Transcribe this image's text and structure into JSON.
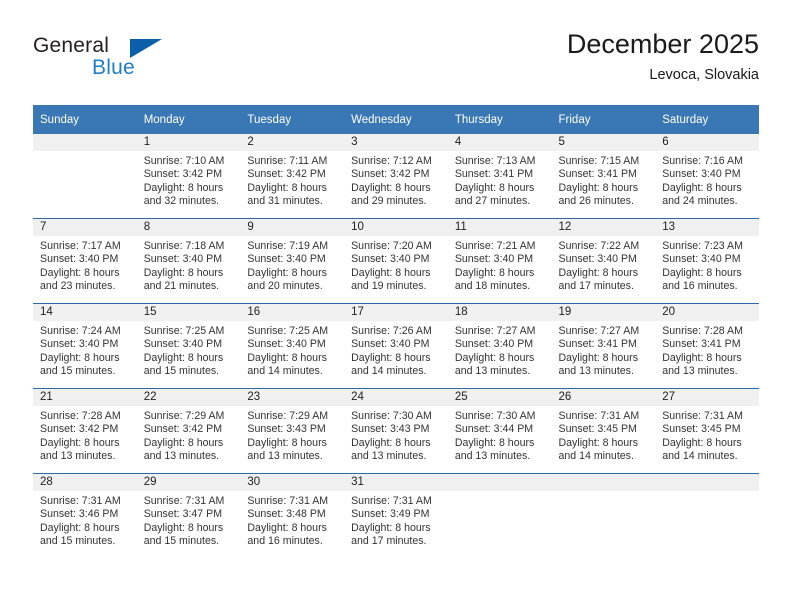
{
  "brand": {
    "name_part1": "General",
    "name_part2": "Blue"
  },
  "header": {
    "title": "December 2025",
    "location": "Levoca, Slovakia"
  },
  "weekday_headers": [
    "Sunday",
    "Monday",
    "Tuesday",
    "Wednesday",
    "Thursday",
    "Friday",
    "Saturday"
  ],
  "colors": {
    "header_blue": "#3978b5",
    "row_divider_blue": "#2a6ba8",
    "daynum_band": "#f0f0f0",
    "logo_blue": "#1f7ec4",
    "logo_triangle": "#0b5ea8"
  },
  "weeks": [
    [
      {
        "day": "",
        "sunrise": "",
        "sunset": "",
        "daylight1": "",
        "daylight2": "",
        "empty": true
      },
      {
        "day": "1",
        "sunrise": "Sunrise: 7:10 AM",
        "sunset": "Sunset: 3:42 PM",
        "daylight1": "Daylight: 8 hours",
        "daylight2": "and 32 minutes.",
        "empty": false
      },
      {
        "day": "2",
        "sunrise": "Sunrise: 7:11 AM",
        "sunset": "Sunset: 3:42 PM",
        "daylight1": "Daylight: 8 hours",
        "daylight2": "and 31 minutes.",
        "empty": false
      },
      {
        "day": "3",
        "sunrise": "Sunrise: 7:12 AM",
        "sunset": "Sunset: 3:42 PM",
        "daylight1": "Daylight: 8 hours",
        "daylight2": "and 29 minutes.",
        "empty": false
      },
      {
        "day": "4",
        "sunrise": "Sunrise: 7:13 AM",
        "sunset": "Sunset: 3:41 PM",
        "daylight1": "Daylight: 8 hours",
        "daylight2": "and 27 minutes.",
        "empty": false
      },
      {
        "day": "5",
        "sunrise": "Sunrise: 7:15 AM",
        "sunset": "Sunset: 3:41 PM",
        "daylight1": "Daylight: 8 hours",
        "daylight2": "and 26 minutes.",
        "empty": false
      },
      {
        "day": "6",
        "sunrise": "Sunrise: 7:16 AM",
        "sunset": "Sunset: 3:40 PM",
        "daylight1": "Daylight: 8 hours",
        "daylight2": "and 24 minutes.",
        "empty": false
      }
    ],
    [
      {
        "day": "7",
        "sunrise": "Sunrise: 7:17 AM",
        "sunset": "Sunset: 3:40 PM",
        "daylight1": "Daylight: 8 hours",
        "daylight2": "and 23 minutes.",
        "empty": false
      },
      {
        "day": "8",
        "sunrise": "Sunrise: 7:18 AM",
        "sunset": "Sunset: 3:40 PM",
        "daylight1": "Daylight: 8 hours",
        "daylight2": "and 21 minutes.",
        "empty": false
      },
      {
        "day": "9",
        "sunrise": "Sunrise: 7:19 AM",
        "sunset": "Sunset: 3:40 PM",
        "daylight1": "Daylight: 8 hours",
        "daylight2": "and 20 minutes.",
        "empty": false
      },
      {
        "day": "10",
        "sunrise": "Sunrise: 7:20 AM",
        "sunset": "Sunset: 3:40 PM",
        "daylight1": "Daylight: 8 hours",
        "daylight2": "and 19 minutes.",
        "empty": false
      },
      {
        "day": "11",
        "sunrise": "Sunrise: 7:21 AM",
        "sunset": "Sunset: 3:40 PM",
        "daylight1": "Daylight: 8 hours",
        "daylight2": "and 18 minutes.",
        "empty": false
      },
      {
        "day": "12",
        "sunrise": "Sunrise: 7:22 AM",
        "sunset": "Sunset: 3:40 PM",
        "daylight1": "Daylight: 8 hours",
        "daylight2": "and 17 minutes.",
        "empty": false
      },
      {
        "day": "13",
        "sunrise": "Sunrise: 7:23 AM",
        "sunset": "Sunset: 3:40 PM",
        "daylight1": "Daylight: 8 hours",
        "daylight2": "and 16 minutes.",
        "empty": false
      }
    ],
    [
      {
        "day": "14",
        "sunrise": "Sunrise: 7:24 AM",
        "sunset": "Sunset: 3:40 PM",
        "daylight1": "Daylight: 8 hours",
        "daylight2": "and 15 minutes.",
        "empty": false
      },
      {
        "day": "15",
        "sunrise": "Sunrise: 7:25 AM",
        "sunset": "Sunset: 3:40 PM",
        "daylight1": "Daylight: 8 hours",
        "daylight2": "and 15 minutes.",
        "empty": false
      },
      {
        "day": "16",
        "sunrise": "Sunrise: 7:25 AM",
        "sunset": "Sunset: 3:40 PM",
        "daylight1": "Daylight: 8 hours",
        "daylight2": "and 14 minutes.",
        "empty": false
      },
      {
        "day": "17",
        "sunrise": "Sunrise: 7:26 AM",
        "sunset": "Sunset: 3:40 PM",
        "daylight1": "Daylight: 8 hours",
        "daylight2": "and 14 minutes.",
        "empty": false
      },
      {
        "day": "18",
        "sunrise": "Sunrise: 7:27 AM",
        "sunset": "Sunset: 3:40 PM",
        "daylight1": "Daylight: 8 hours",
        "daylight2": "and 13 minutes.",
        "empty": false
      },
      {
        "day": "19",
        "sunrise": "Sunrise: 7:27 AM",
        "sunset": "Sunset: 3:41 PM",
        "daylight1": "Daylight: 8 hours",
        "daylight2": "and 13 minutes.",
        "empty": false
      },
      {
        "day": "20",
        "sunrise": "Sunrise: 7:28 AM",
        "sunset": "Sunset: 3:41 PM",
        "daylight1": "Daylight: 8 hours",
        "daylight2": "and 13 minutes.",
        "empty": false
      }
    ],
    [
      {
        "day": "21",
        "sunrise": "Sunrise: 7:28 AM",
        "sunset": "Sunset: 3:42 PM",
        "daylight1": "Daylight: 8 hours",
        "daylight2": "and 13 minutes.",
        "empty": false
      },
      {
        "day": "22",
        "sunrise": "Sunrise: 7:29 AM",
        "sunset": "Sunset: 3:42 PM",
        "daylight1": "Daylight: 8 hours",
        "daylight2": "and 13 minutes.",
        "empty": false
      },
      {
        "day": "23",
        "sunrise": "Sunrise: 7:29 AM",
        "sunset": "Sunset: 3:43 PM",
        "daylight1": "Daylight: 8 hours",
        "daylight2": "and 13 minutes.",
        "empty": false
      },
      {
        "day": "24",
        "sunrise": "Sunrise: 7:30 AM",
        "sunset": "Sunset: 3:43 PM",
        "daylight1": "Daylight: 8 hours",
        "daylight2": "and 13 minutes.",
        "empty": false
      },
      {
        "day": "25",
        "sunrise": "Sunrise: 7:30 AM",
        "sunset": "Sunset: 3:44 PM",
        "daylight1": "Daylight: 8 hours",
        "daylight2": "and 13 minutes.",
        "empty": false
      },
      {
        "day": "26",
        "sunrise": "Sunrise: 7:31 AM",
        "sunset": "Sunset: 3:45 PM",
        "daylight1": "Daylight: 8 hours",
        "daylight2": "and 14 minutes.",
        "empty": false
      },
      {
        "day": "27",
        "sunrise": "Sunrise: 7:31 AM",
        "sunset": "Sunset: 3:45 PM",
        "daylight1": "Daylight: 8 hours",
        "daylight2": "and 14 minutes.",
        "empty": false
      }
    ],
    [
      {
        "day": "28",
        "sunrise": "Sunrise: 7:31 AM",
        "sunset": "Sunset: 3:46 PM",
        "daylight1": "Daylight: 8 hours",
        "daylight2": "and 15 minutes.",
        "empty": false
      },
      {
        "day": "29",
        "sunrise": "Sunrise: 7:31 AM",
        "sunset": "Sunset: 3:47 PM",
        "daylight1": "Daylight: 8 hours",
        "daylight2": "and 15 minutes.",
        "empty": false
      },
      {
        "day": "30",
        "sunrise": "Sunrise: 7:31 AM",
        "sunset": "Sunset: 3:48 PM",
        "daylight1": "Daylight: 8 hours",
        "daylight2": "and 16 minutes.",
        "empty": false
      },
      {
        "day": "31",
        "sunrise": "Sunrise: 7:31 AM",
        "sunset": "Sunset: 3:49 PM",
        "daylight1": "Daylight: 8 hours",
        "daylight2": "and 17 minutes.",
        "empty": false
      },
      {
        "day": "",
        "sunrise": "",
        "sunset": "",
        "daylight1": "",
        "daylight2": "",
        "empty": true
      },
      {
        "day": "",
        "sunrise": "",
        "sunset": "",
        "daylight1": "",
        "daylight2": "",
        "empty": true
      },
      {
        "day": "",
        "sunrise": "",
        "sunset": "",
        "daylight1": "",
        "daylight2": "",
        "empty": true
      }
    ]
  ]
}
